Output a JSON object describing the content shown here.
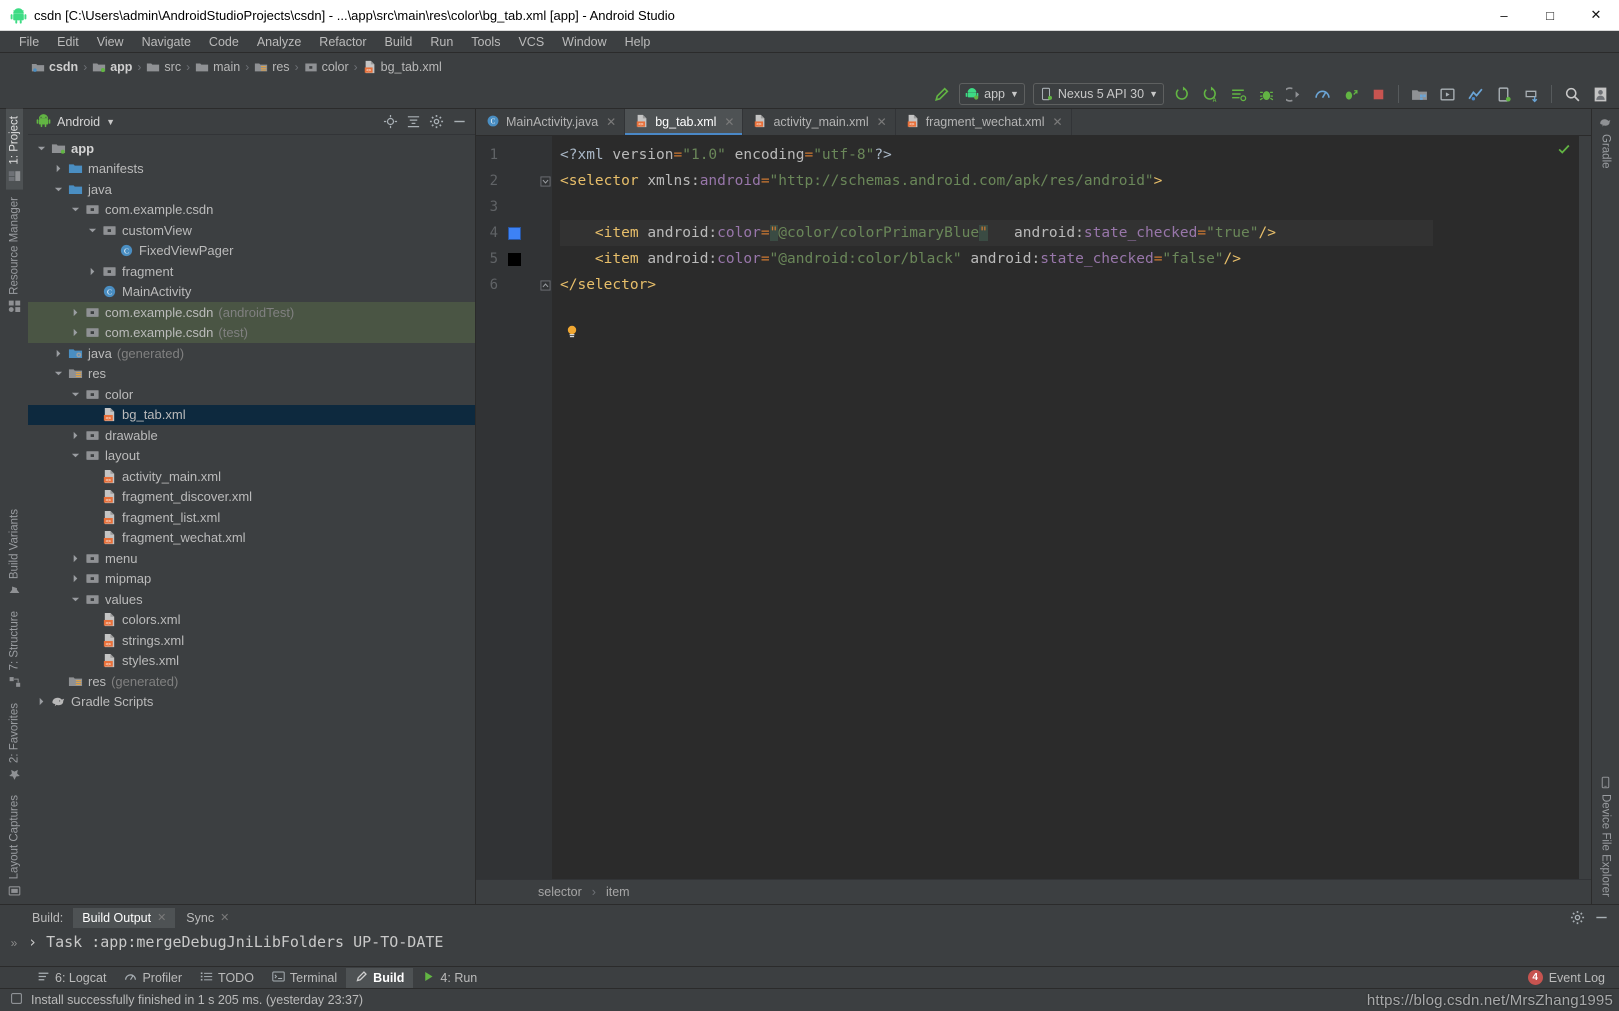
{
  "window": {
    "title": "csdn [C:\\Users\\admin\\AndroidStudioProjects\\csdn] - ...\\app\\src\\main\\res\\color\\bg_tab.xml [app] - Android Studio",
    "app_icon": "android-robot-icon",
    "minimize": "–",
    "maximize": "□",
    "close": "✕"
  },
  "menubar": {
    "items": [
      "File",
      "Edit",
      "View",
      "Navigate",
      "Code",
      "Analyze",
      "Refactor",
      "Build",
      "Run",
      "Tools",
      "VCS",
      "Window",
      "Help"
    ]
  },
  "navbar": {
    "crumbs": [
      {
        "label": "csdn",
        "icon": "module-icon",
        "bold": true
      },
      {
        "label": "app",
        "icon": "app-module-icon",
        "bold": true
      },
      {
        "label": "src",
        "icon": "folder-icon",
        "bold": false
      },
      {
        "label": "main",
        "icon": "folder-icon",
        "bold": false
      },
      {
        "label": "res",
        "icon": "res-folder-icon",
        "bold": false
      },
      {
        "label": "color",
        "icon": "folder-icon",
        "bold": false
      },
      {
        "label": "bg_tab.xml",
        "icon": "xml-file-icon",
        "bold": false
      }
    ],
    "separator": "›"
  },
  "toolbar": {
    "run_config": "app",
    "device": "Nexus 5 API 30",
    "buttons": [
      "make-project-icon",
      "sync-gradle-icon",
      "avd-manager-icon",
      "sdk-manager-icon",
      "run-icon",
      "debug-icon",
      "run-coverage-icon",
      "profiler-icon",
      "attach-debugger-icon",
      "stop-icon",
      "layout-inspector-icon",
      "device-manager-icon",
      "search-icon",
      "profile-icon"
    ]
  },
  "left_strip": {
    "top": [
      {
        "label": "1: Project",
        "icon": "project-icon",
        "active": true
      },
      {
        "label": "Resource Manager",
        "icon": "resource-manager-icon",
        "active": false
      }
    ],
    "bottom": [
      {
        "label": "Build Variants",
        "icon": "build-variants-icon",
        "active": false
      },
      {
        "label": "7: Structure",
        "icon": "structure-icon",
        "active": false
      },
      {
        "label": "2: Favorites",
        "icon": "star-icon",
        "active": false
      },
      {
        "label": "Layout Captures",
        "icon": "layout-captures-icon",
        "active": false
      }
    ]
  },
  "right_strip": {
    "top": [
      {
        "label": "Gradle",
        "icon": "gradle-elephant-icon"
      }
    ],
    "bottom": [
      {
        "label": "Device File Explorer",
        "icon": "device-file-explorer-icon"
      }
    ]
  },
  "project_panel": {
    "title": "Android",
    "dropdown_caret": "▾",
    "header_actions": [
      "locate-icon",
      "collapse-all-icon",
      "settings-gear-icon",
      "hide-icon"
    ],
    "tree": [
      {
        "depth": 0,
        "label": "app",
        "arrow": "down",
        "icon": "app-module-icon",
        "bold": true
      },
      {
        "depth": 1,
        "label": "manifests",
        "arrow": "right",
        "icon": "folder-blue-icon"
      },
      {
        "depth": 1,
        "label": "java",
        "arrow": "down",
        "icon": "folder-blue-icon"
      },
      {
        "depth": 2,
        "label": "com.example.csdn",
        "arrow": "down",
        "icon": "package-icon"
      },
      {
        "depth": 3,
        "label": "customView",
        "arrow": "down",
        "icon": "package-icon"
      },
      {
        "depth": 4,
        "label": "FixedViewPager",
        "arrow": "none",
        "icon": "java-class-icon"
      },
      {
        "depth": 3,
        "label": "fragment",
        "arrow": "right",
        "icon": "package-icon"
      },
      {
        "depth": 3,
        "label": "MainActivity",
        "arrow": "none",
        "icon": "java-class-icon"
      },
      {
        "depth": 2,
        "label": "com.example.csdn",
        "dim": "(androidTest)",
        "arrow": "right",
        "icon": "package-icon",
        "testsrc": true
      },
      {
        "depth": 2,
        "label": "com.example.csdn",
        "dim": "(test)",
        "arrow": "right",
        "icon": "package-icon",
        "testsrc": true
      },
      {
        "depth": 1,
        "label": "java",
        "dim": "(generated)",
        "arrow": "right",
        "icon": "folder-generated-icon"
      },
      {
        "depth": 1,
        "label": "res",
        "arrow": "down",
        "icon": "res-folder-icon"
      },
      {
        "depth": 2,
        "label": "color",
        "arrow": "down",
        "icon": "package-icon"
      },
      {
        "depth": 3,
        "label": "bg_tab.xml",
        "arrow": "none",
        "icon": "xml-file-icon",
        "selected": true
      },
      {
        "depth": 2,
        "label": "drawable",
        "arrow": "right",
        "icon": "package-icon"
      },
      {
        "depth": 2,
        "label": "layout",
        "arrow": "down",
        "icon": "package-icon"
      },
      {
        "depth": 3,
        "label": "activity_main.xml",
        "arrow": "none",
        "icon": "xml-file-icon"
      },
      {
        "depth": 3,
        "label": "fragment_discover.xml",
        "arrow": "none",
        "icon": "xml-file-icon"
      },
      {
        "depth": 3,
        "label": "fragment_list.xml",
        "arrow": "none",
        "icon": "xml-file-icon"
      },
      {
        "depth": 3,
        "label": "fragment_wechat.xml",
        "arrow": "none",
        "icon": "xml-file-icon"
      },
      {
        "depth": 2,
        "label": "menu",
        "arrow": "right",
        "icon": "package-icon"
      },
      {
        "depth": 2,
        "label": "mipmap",
        "arrow": "right",
        "icon": "package-icon"
      },
      {
        "depth": 2,
        "label": "values",
        "arrow": "down",
        "icon": "package-icon"
      },
      {
        "depth": 3,
        "label": "colors.xml",
        "arrow": "none",
        "icon": "xml-file-icon"
      },
      {
        "depth": 3,
        "label": "strings.xml",
        "arrow": "none",
        "icon": "xml-file-icon"
      },
      {
        "depth": 3,
        "label": "styles.xml",
        "arrow": "none",
        "icon": "xml-file-icon"
      },
      {
        "depth": 1,
        "label": "res",
        "dim": "(generated)",
        "arrow": "none",
        "icon": "res-folder-icon"
      },
      {
        "depth": 0,
        "label": "Gradle Scripts",
        "arrow": "right",
        "icon": "gradle-elephant-icon"
      }
    ]
  },
  "editor": {
    "tabs": [
      {
        "label": "MainActivity.java",
        "icon": "java-class-icon",
        "active": false,
        "close": "✕"
      },
      {
        "label": "bg_tab.xml",
        "icon": "xml-file-icon",
        "active": true,
        "close": "✕"
      },
      {
        "label": "activity_main.xml",
        "icon": "xml-file-icon",
        "active": false,
        "close": "✕"
      },
      {
        "label": "fragment_wechat.xml",
        "icon": "xml-file-icon",
        "active": false,
        "close": "✕"
      }
    ],
    "line_numbers": [
      "1",
      "2",
      "3",
      "4",
      "5",
      "6"
    ],
    "gutter_swatches": {
      "line4": "#3d82f5",
      "line5": "#000000"
    },
    "inspection_status": "ok-check-icon",
    "code_text": [
      "<?xml version=\"1.0\" encoding=\"utf-8\"?>",
      "<selector xmlns:android=\"http://schemas.android.com/apk/res/android\">",
      "",
      "    <item android:color=\"@color/colorPrimaryBlue\"   android:state_checked=\"true\"/>",
      "    <item android:color=\"@android:color/black\" android:state_checked=\"false\"/>",
      "</selector>"
    ],
    "breadcrumbs": [
      "selector",
      "item"
    ],
    "breadcrumb_sep": "›"
  },
  "build_panel": {
    "label": "Build:",
    "tabs": [
      {
        "label": "Build Output",
        "active": true,
        "close": "✕"
      },
      {
        "label": "Sync",
        "active": false,
        "close": "✕"
      }
    ],
    "expander": "»",
    "arrow": "›",
    "output_line": "Task :app:mergeDebugJniLibFolders UP-TO-DATE",
    "actions": [
      "settings-gear-icon",
      "hide-icon"
    ]
  },
  "bottom_strip": {
    "tools": [
      {
        "label": "6: Logcat",
        "icon": "logcat-icon",
        "active": false,
        "mnemonic": "6"
      },
      {
        "label": "Profiler",
        "icon": "profiler-icon",
        "active": false
      },
      {
        "label": "TODO",
        "icon": "todo-icon",
        "active": false
      },
      {
        "label": "Terminal",
        "icon": "terminal-icon",
        "active": false
      },
      {
        "label": "Build",
        "icon": "build-hammer-icon",
        "active": true
      },
      {
        "label": "4: Run",
        "icon": "run-play-icon",
        "active": false,
        "mnemonic": "4"
      }
    ],
    "event_log": {
      "label": "Event Log",
      "count": "4"
    }
  },
  "statusbar": {
    "message": "Install successfully finished in 1 s 205 ms. (yesterday 23:37)",
    "icon": "status-message-icon"
  },
  "watermark": "https://blog.csdn.net/MrsZhang1995",
  "colors": {
    "accent_blue": "#4a88c7",
    "swatch_blue": "#3d82f5",
    "swatch_black": "#000000",
    "panel_bg": "#3c3f41",
    "editor_bg": "#2b2b2b",
    "selection_bg": "#0d293e",
    "testsrc_bg": "#4a5544",
    "badge_red": "#c75450"
  }
}
